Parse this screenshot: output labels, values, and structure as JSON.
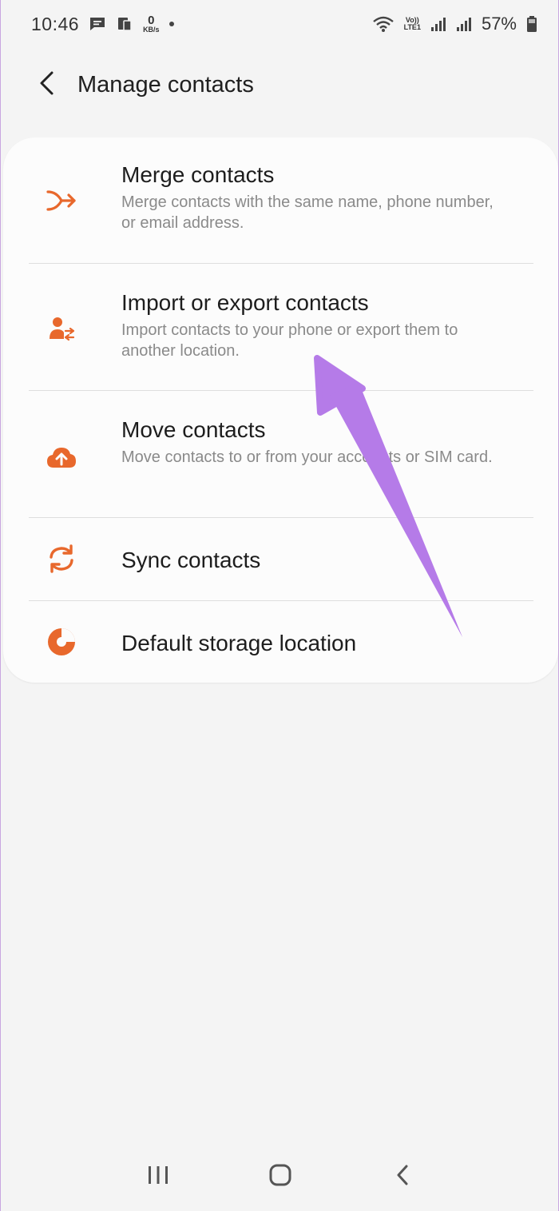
{
  "status_bar": {
    "time": "10:46",
    "data_rate_value": "0",
    "data_rate_unit": "KB/s",
    "volte_top": "Vo))",
    "volte_bottom": "LTE1",
    "battery_percent": "57%"
  },
  "header": {
    "title": "Manage contacts"
  },
  "menu": {
    "items": [
      {
        "title": "Merge contacts",
        "subtitle": "Merge contacts with the same name, phone number, or email address.",
        "icon": "merge-icon"
      },
      {
        "title": "Import or export contacts",
        "subtitle": "Import contacts to your phone or export them to another location.",
        "icon": "import-export-icon"
      },
      {
        "title": "Move contacts",
        "subtitle": "Move contacts to or from your accounts or SIM card.",
        "icon": "cloud-upload-icon"
      },
      {
        "title": "Sync contacts",
        "icon": "sync-icon"
      },
      {
        "title": "Default storage location",
        "icon": "storage-icon"
      }
    ]
  },
  "colors": {
    "accent": "#e8682c",
    "annotation_arrow": "#b57be8",
    "background": "#f4f4f4",
    "card": "#fcfcfc"
  }
}
